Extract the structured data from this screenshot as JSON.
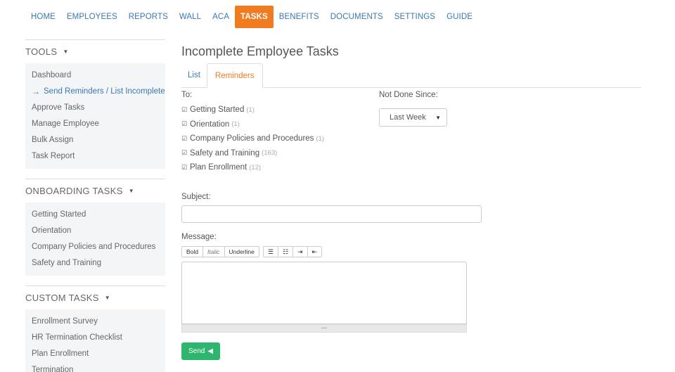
{
  "topnav": {
    "items": [
      "HOME",
      "EMPLOYEES",
      "REPORTS",
      "WALL",
      "ACA",
      "TASKS",
      "BENEFITS",
      "DOCUMENTS",
      "SETTINGS",
      "GUIDE"
    ],
    "active_index": 5
  },
  "sidebar": {
    "tools": {
      "title": "TOOLS",
      "items": [
        "Dashboard",
        "Send Reminders / List Incomplete",
        "Approve Tasks",
        "Manage Employee",
        "Bulk Assign",
        "Task Report"
      ],
      "current_index": 1
    },
    "onboarding": {
      "title": "ONBOARDING TASKS",
      "items": [
        "Getting Started",
        "Orientation",
        "Company Policies and Procedures",
        "Safety and Training"
      ]
    },
    "custom": {
      "title": "CUSTOM TASKS",
      "items": [
        "Enrollment Survey",
        "HR Termination Checklist",
        "Plan Enrollment",
        "Termination"
      ]
    }
  },
  "main": {
    "title": "Incomplete Employee Tasks",
    "tabs": [
      "List",
      "Reminders"
    ],
    "active_tab": 1,
    "to_label": "To:",
    "recipients": [
      {
        "label": "Getting Started",
        "count": "(1)",
        "checked": true
      },
      {
        "label": "Orientation",
        "count": "(1)",
        "checked": true
      },
      {
        "label": "Company Policies and Procedures",
        "count": "(1)",
        "checked": true
      },
      {
        "label": "Safety and Training",
        "count": "(163)",
        "checked": true
      },
      {
        "label": "Plan Enrollment",
        "count": "(12)",
        "checked": true
      }
    ],
    "not_done_label": "Not Done Since:",
    "not_done_value": "Last Week",
    "subject_label": "Subject:",
    "subject_value": "",
    "message_label": "Message:",
    "toolbar": {
      "bold": "Bold",
      "italic": "Italic",
      "underline": "Underline"
    },
    "resize_handle": "...",
    "send_label": "Send"
  },
  "colors": {
    "accent": "#f07c22",
    "link": "#3a78b5",
    "send": "#2fb66e"
  }
}
